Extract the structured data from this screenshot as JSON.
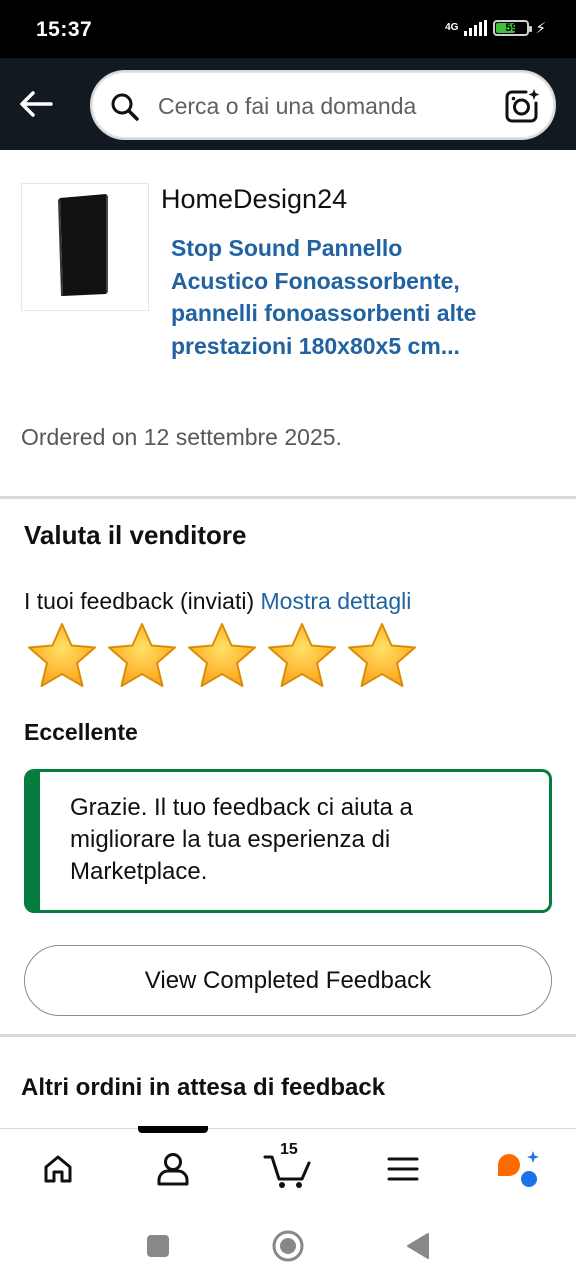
{
  "status_bar": {
    "time": "15:37",
    "network": "4G",
    "battery_percent": "59",
    "battery_level": 0.59,
    "signal_icon": "signal-icon",
    "charging_icon": "bolt-icon"
  },
  "top_bar": {
    "back_icon": "arrow-left-icon",
    "search_placeholder": "Cerca o fai una domanda",
    "search_value": "",
    "search_icon": "search-icon",
    "camera_icon": "camera-lens-icon"
  },
  "order": {
    "seller": "HomeDesign24",
    "product_title": "Stop Sound Pannello Acustico Fonoassorbente, pannelli fonoassorbenti alte prestazioni 180x80x5 cm...",
    "ordered_on": "Ordered on 12 settembre 2025."
  },
  "rate_seller": {
    "heading": "Valuta il venditore",
    "feedback_prefix": "I tuoi feedback (inviati)",
    "details_link": "Mostra dettagli",
    "rating": 5,
    "max_rating": 5,
    "rating_label": "Eccellente",
    "thanks_message": "Grazie. Il tuo feedback ci aiuta a migliorare la tua esperienza di Marketplace.",
    "view_button": "View Completed Feedback"
  },
  "others": {
    "heading": "Altri ordini in attesa di feedback"
  },
  "bottom_nav": {
    "items": [
      "home-icon",
      "account-icon",
      "cart-icon",
      "menu-icon",
      "rufus-icon"
    ],
    "cart_count": "15",
    "active_index": 1
  },
  "colors": {
    "header_bg": "#131921",
    "link": "#2162a1",
    "success_border": "#067d3e",
    "star": "#ffa41c",
    "rufus_orange": "#ff6a00",
    "rufus_blue": "#1a73e8"
  }
}
